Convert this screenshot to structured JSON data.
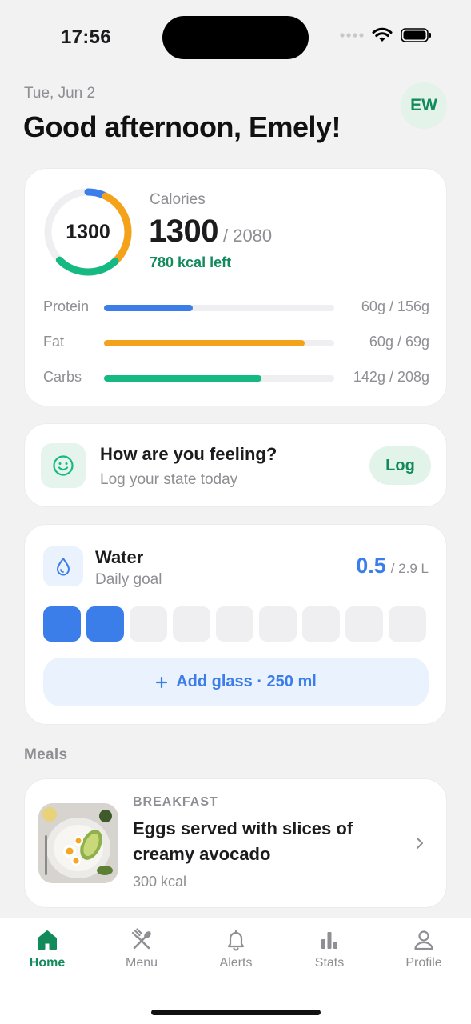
{
  "status_bar": {
    "time": "17:56"
  },
  "header": {
    "date": "Tue, Jun 2",
    "greeting": "Good afternoon, Emely!",
    "avatar_initials": "EW"
  },
  "calories": {
    "ring_value": "1300",
    "label": "Calories",
    "current": "1300",
    "goal": "/ 2080",
    "left": "780 kcal left",
    "ring_segments": [
      {
        "color": "#3b7de9",
        "fraction": 0.073
      },
      {
        "color": "#f5a21b",
        "fraction": 0.307
      },
      {
        "color": "#15b981",
        "fraction": 0.245
      }
    ],
    "macros": [
      {
        "name": "Protein",
        "value": "60g / 156g",
        "fraction": 0.385,
        "color": "#3b7de9"
      },
      {
        "name": "Fat",
        "value": "60g / 69g",
        "fraction": 0.87,
        "color": "#f5a21b"
      },
      {
        "name": "Carbs",
        "value": "142g / 208g",
        "fraction": 0.683,
        "color": "#15b981"
      }
    ]
  },
  "feeling": {
    "icon": "smiley-icon",
    "title": "How are you feeling?",
    "subtitle": "Log your state today",
    "button": "Log"
  },
  "water": {
    "icon": "water-drop-icon",
    "title": "Water",
    "subtitle": "Daily goal",
    "current": "0.5",
    "goal": "/ 2.9 L",
    "glasses_filled": 2,
    "glasses_total": 9,
    "add_button": "Add glass · 250 ml"
  },
  "meals": {
    "section_title": "Meals",
    "items": [
      {
        "type": "BREAKFAST",
        "name": "Eggs served with slices of creamy avocado",
        "kcal": "300 kcal"
      }
    ]
  },
  "tabs": [
    {
      "label": "Home",
      "icon": "home-icon",
      "active": true
    },
    {
      "label": "Menu",
      "icon": "fork-knife-icon",
      "active": false
    },
    {
      "label": "Alerts",
      "icon": "bell-icon",
      "active": false
    },
    {
      "label": "Stats",
      "icon": "bar-chart-icon",
      "active": false
    },
    {
      "label": "Profile",
      "icon": "person-icon",
      "active": false
    }
  ],
  "colors": {
    "accent_green": "#128a5a",
    "accent_blue": "#3b7de9",
    "accent_orange": "#f5a21b",
    "background": "#f2f2f3"
  }
}
